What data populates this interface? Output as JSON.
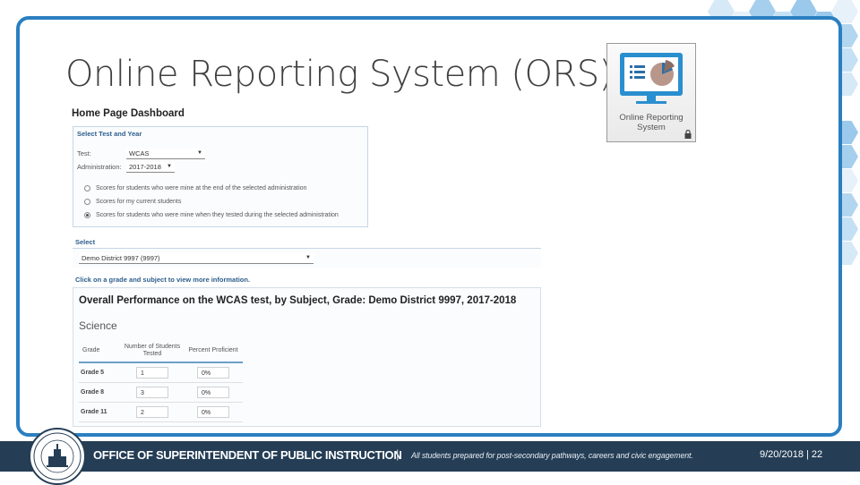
{
  "slide": {
    "title": "Online Reporting System (ORS)",
    "footer": {
      "org": "OFFICE OF SUPERINTENDENT OF PUBLIC INSTRUCTION",
      "separator": "|",
      "tagline": "All students prepared for post-secondary pathways, careers and civic engagement.",
      "date_page": "9/20/2018 | 22"
    }
  },
  "ors_logo": {
    "line1": "Online Reporting",
    "line2": "System",
    "icon": "monitor-pie-chart-icon"
  },
  "dashboard": {
    "title": "Home Page Dashboard",
    "select_test_year": {
      "heading": "Select Test and Year",
      "test_label": "Test:",
      "test_value": "WCAS",
      "admin_label": "Administration:",
      "admin_value": "2017-2018",
      "radios": [
        {
          "label": "Scores for students who were mine at the end of the selected administration",
          "selected": false
        },
        {
          "label": "Scores for my current students",
          "selected": false
        },
        {
          "label": "Scores for students who were mine when they tested during the selected administration",
          "selected": true
        }
      ]
    },
    "select": {
      "heading": "Select",
      "district_value": "Demo District 9997 (9997)"
    },
    "instruction": "Click on a grade and subject to view more information.",
    "overall": {
      "title": "Overall Performance on the WCAS test, by Subject, Grade: Demo District 9997, 2017-2018",
      "subject": "Science",
      "columns": [
        "Grade",
        "Number of Students Tested",
        "Percent Proficient"
      ],
      "rows": [
        {
          "grade": "Grade 5",
          "tested": "1",
          "percent": "0%"
        },
        {
          "grade": "Grade 8",
          "tested": "3",
          "percent": "0%"
        },
        {
          "grade": "Grade 11",
          "tested": "2",
          "percent": "0%"
        }
      ]
    }
  },
  "colors": {
    "frame": "#2a7fc1",
    "footer_bg": "#253e56",
    "accent": "#2c5e8c"
  }
}
